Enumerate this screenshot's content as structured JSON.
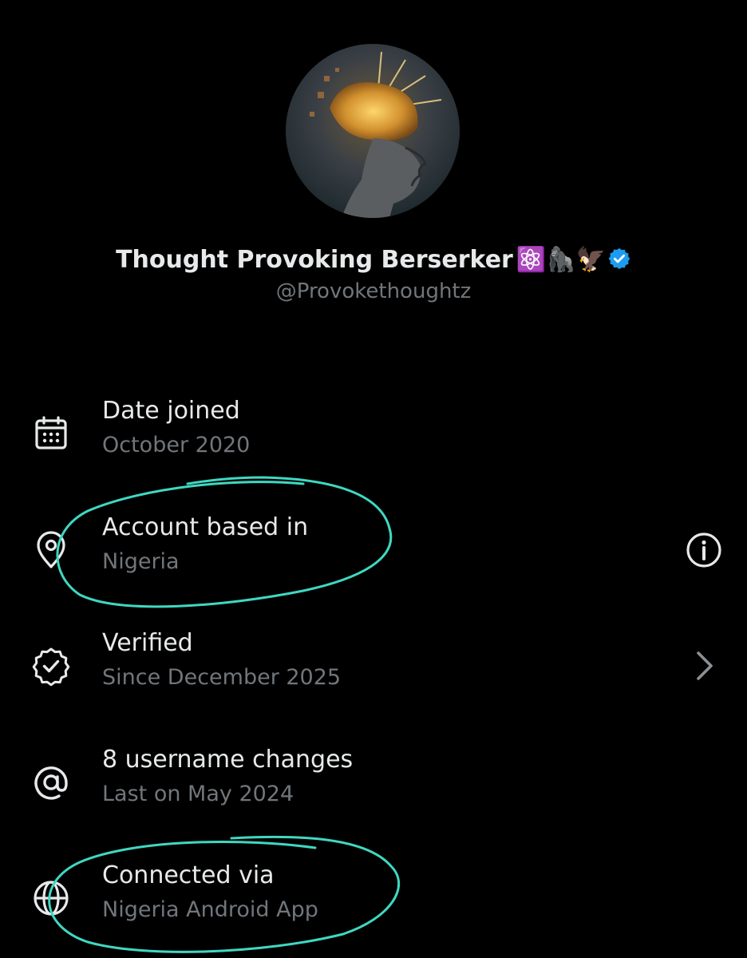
{
  "profile": {
    "display_name": "Thought Provoking Berserker",
    "name_emojis": "⚛️🦍🦅",
    "handle": "@Provokethoughtz"
  },
  "rows": [
    {
      "title": "Date joined",
      "subtitle": "October 2020",
      "icon": "calendar-icon"
    },
    {
      "title": "Account based in",
      "subtitle": "Nigeria",
      "icon": "location-pin-icon",
      "trailing": "info-icon"
    },
    {
      "title": "Verified",
      "subtitle": "Since December 2025",
      "icon": "verified-seal-icon",
      "trailing": "chevron-right-icon"
    },
    {
      "title": "8 username changes",
      "subtitle": "Last on May 2024",
      "icon": "at-sign-icon"
    },
    {
      "title": "Connected via",
      "subtitle": "Nigeria Android App",
      "icon": "globe-icon"
    }
  ],
  "colors": {
    "background": "#000000",
    "primary_text": "#e7e9ea",
    "secondary_text": "#71767b",
    "verified_blue": "#1d9bf0",
    "annotation": "#3fd8c2"
  }
}
